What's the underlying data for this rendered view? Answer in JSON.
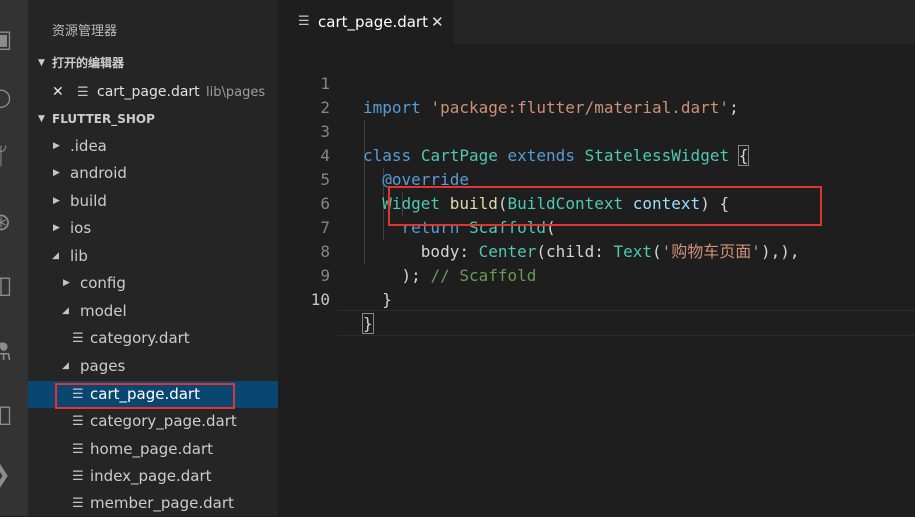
{
  "activity_bar": {
    "icons": [
      "explorer-icon",
      "search-icon",
      "source-control-icon",
      "debug-icon",
      "extensions-icon",
      "test-icon",
      "remote-icon",
      "terminal-icon"
    ]
  },
  "sidebar": {
    "title": "资源管理器",
    "open_editors": {
      "label": "打开的编辑器",
      "items": [
        {
          "close": "✕",
          "name": "cart_page.dart",
          "path": "lib\\pages"
        }
      ]
    },
    "project": {
      "label": "FLUTTER_SHOP",
      "tree": [
        {
          "label": ".idea",
          "kind": "folder-collapsed"
        },
        {
          "label": "android",
          "kind": "folder-collapsed"
        },
        {
          "label": "build",
          "kind": "folder-collapsed"
        },
        {
          "label": "ios",
          "kind": "folder-collapsed"
        },
        {
          "label": "lib",
          "kind": "folder-expanded"
        },
        {
          "label": "config",
          "kind": "folder-collapsed"
        },
        {
          "label": "model",
          "kind": "folder-expanded"
        },
        {
          "label": "category.dart",
          "kind": "file"
        },
        {
          "label": "pages",
          "kind": "folder-expanded"
        },
        {
          "label": "cart_page.dart",
          "kind": "file",
          "selected": true
        },
        {
          "label": "category_page.dart",
          "kind": "file"
        },
        {
          "label": "home_page.dart",
          "kind": "file"
        },
        {
          "label": "index_page.dart",
          "kind": "file"
        },
        {
          "label": "member_page.dart",
          "kind": "file"
        }
      ]
    }
  },
  "editor": {
    "tab": {
      "name": "cart_page.dart",
      "close": "✕"
    },
    "line_numbers": [
      "1",
      "2",
      "3",
      "4",
      "5",
      "6",
      "7",
      "8",
      "9",
      "10"
    ],
    "code": {
      "l1": {
        "kw": "import",
        "str": "'package:flutter/material.dart'",
        "end": ";"
      },
      "l3": {
        "kw1": "class",
        "cls": "CartPage",
        "kw2": "extends",
        "base": "StatelessWidget",
        "brace": "{"
      },
      "l4": {
        "ann": "@override"
      },
      "l5": {
        "ret": "Widget",
        "fn": "build",
        "open": "(",
        "ptype": "BuildContext",
        "pname": "context",
        "end": ") {"
      },
      "l6": {
        "kw": "return",
        "cls": "Scaffold",
        "open": "("
      },
      "l7": {
        "prop": "body:",
        "cls": "Center",
        "open": "(",
        "prop2": "child:",
        "cls2": "Text",
        "open2": "(",
        "str": "'购物车页面'",
        "end": "),),"
      },
      "l8": {
        "close": ");",
        "comment": "// Scaffold"
      },
      "l9": {
        "close": "}"
      },
      "l10": {
        "close": "}"
      }
    }
  },
  "colors": {
    "highlight_box": "#e03434",
    "selection": "#094771",
    "keyword": "#569cd6",
    "string": "#ce9178",
    "type": "#4ec9b0"
  }
}
